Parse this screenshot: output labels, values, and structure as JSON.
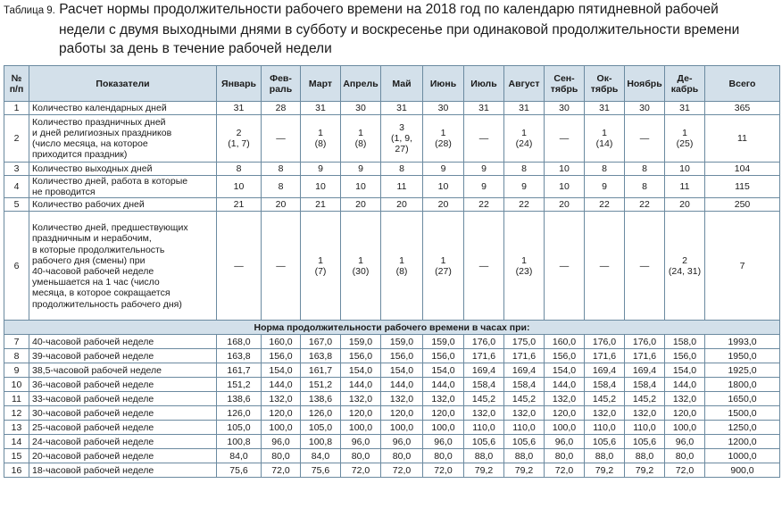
{
  "title": {
    "label": "Таблица 9.",
    "line1": "Расчет нормы продолжительности рабочего времени на 2018 год по календарю пятидневной рабочей",
    "line2": "недели с двумя выходными днями в субботу и воскресенье при одинаковой продолжительности времени",
    "line3": "работы за день в течение рабочей недели"
  },
  "headers": {
    "num": "№\nп/п",
    "indicator": "Показатели",
    "months": [
      "Январь",
      "Фев-\nраль",
      "Март",
      "Апрель",
      "Май",
      "Июнь",
      "Июль",
      "Август",
      "Сен-\nтябрь",
      "Ок-\nтябрь",
      "Ноябрь",
      "Де-\nкабрь"
    ],
    "total": "Всего"
  },
  "rows": [
    {
      "n": "1",
      "label": "Количество календарных дней",
      "vals": [
        "31",
        "28",
        "31",
        "30",
        "31",
        "30",
        "31",
        "31",
        "30",
        "31",
        "30",
        "31"
      ],
      "total": "365"
    },
    {
      "n": "2",
      "label": "Количество праздничных дней\nи дней религиозных праздников\n(число месяца, на которое\nприходится праздник)",
      "vals": [
        "2\n(1, 7)",
        "—",
        "1\n(8)",
        "1\n(8)",
        "3\n(1, 9,\n27)",
        "1\n(28)",
        "—",
        "1\n(24)",
        "—",
        "1\n(14)",
        "—",
        "1\n(25)"
      ],
      "total": "11"
    },
    {
      "n": "3",
      "label": "Количество выходных дней",
      "vals": [
        "8",
        "8",
        "9",
        "9",
        "8",
        "9",
        "9",
        "8",
        "10",
        "8",
        "8",
        "10"
      ],
      "total": "104"
    },
    {
      "n": "4",
      "label": "Количество дней, работа в которые\nне проводится",
      "vals": [
        "10",
        "8",
        "10",
        "10",
        "11",
        "10",
        "9",
        "9",
        "10",
        "9",
        "8",
        "11"
      ],
      "total": "115"
    },
    {
      "n": "5",
      "label": "Количество рабочих дней",
      "vals": [
        "21",
        "20",
        "21",
        "20",
        "20",
        "20",
        "22",
        "22",
        "20",
        "22",
        "22",
        "20"
      ],
      "total": "250"
    },
    {
      "n": "6",
      "label": "Количество дней, предшествующих\nпраздничным и нерабочим,\nв которые продолжительность\nрабочего дня (смены) при\n40-часовой рабочей неделе\nуменьшается на 1 час (число\nмесяца, в которое сокращается\nпродолжительность рабочего дня)",
      "vals": [
        "—",
        "—",
        "1\n(7)",
        "1\n(30)",
        "1\n(8)",
        "1\n(27)",
        "—",
        "1\n(23)",
        "—",
        "—",
        "—",
        "2\n(24, 31)"
      ],
      "total": "7"
    }
  ],
  "section": "Норма продолжительности рабочего времени в часах при:",
  "norm_rows": [
    {
      "n": "7",
      "label": "40-часовой рабочей неделе",
      "vals": [
        "168,0",
        "160,0",
        "167,0",
        "159,0",
        "159,0",
        "159,0",
        "176,0",
        "175,0",
        "160,0",
        "176,0",
        "176,0",
        "158,0"
      ],
      "total": "1993,0"
    },
    {
      "n": "8",
      "label": "39-часовой рабочей неделе",
      "vals": [
        "163,8",
        "156,0",
        "163,8",
        "156,0",
        "156,0",
        "156,0",
        "171,6",
        "171,6",
        "156,0",
        "171,6",
        "171,6",
        "156,0"
      ],
      "total": "1950,0"
    },
    {
      "n": "9",
      "label": "38,5-часовой рабочей неделе",
      "vals": [
        "161,7",
        "154,0",
        "161,7",
        "154,0",
        "154,0",
        "154,0",
        "169,4",
        "169,4",
        "154,0",
        "169,4",
        "169,4",
        "154,0"
      ],
      "total": "1925,0"
    },
    {
      "n": "10",
      "label": "36-часовой рабочей неделе",
      "vals": [
        "151,2",
        "144,0",
        "151,2",
        "144,0",
        "144,0",
        "144,0",
        "158,4",
        "158,4",
        "144,0",
        "158,4",
        "158,4",
        "144,0"
      ],
      "total": "1800,0"
    },
    {
      "n": "11",
      "label": "33-часовой рабочей неделе",
      "vals": [
        "138,6",
        "132,0",
        "138,6",
        "132,0",
        "132,0",
        "132,0",
        "145,2",
        "145,2",
        "132,0",
        "145,2",
        "145,2",
        "132,0"
      ],
      "total": "1650,0"
    },
    {
      "n": "12",
      "label": "30-часовой рабочей неделе",
      "vals": [
        "126,0",
        "120,0",
        "126,0",
        "120,0",
        "120,0",
        "120,0",
        "132,0",
        "132,0",
        "120,0",
        "132,0",
        "132,0",
        "120,0"
      ],
      "total": "1500,0"
    },
    {
      "n": "13",
      "label": "25-часовой рабочей неделе",
      "vals": [
        "105,0",
        "100,0",
        "105,0",
        "100,0",
        "100,0",
        "100,0",
        "110,0",
        "110,0",
        "100,0",
        "110,0",
        "110,0",
        "100,0"
      ],
      "total": "1250,0"
    },
    {
      "n": "14",
      "label": "24-часовой рабочей неделе",
      "vals": [
        "100,8",
        "96,0",
        "100,8",
        "96,0",
        "96,0",
        "96,0",
        "105,6",
        "105,6",
        "96,0",
        "105,6",
        "105,6",
        "96,0"
      ],
      "total": "1200,0"
    },
    {
      "n": "15",
      "label": "20-часовой рабочей неделе",
      "vals": [
        "84,0",
        "80,0",
        "84,0",
        "80,0",
        "80,0",
        "80,0",
        "88,0",
        "88,0",
        "80,0",
        "88,0",
        "88,0",
        "80,0"
      ],
      "total": "1000,0"
    },
    {
      "n": "16",
      "label": "18-часовой рабочей неделе",
      "vals": [
        "75,6",
        "72,0",
        "75,6",
        "72,0",
        "72,0",
        "72,0",
        "79,2",
        "79,2",
        "72,0",
        "79,2",
        "79,2",
        "72,0"
      ],
      "total": "900,0"
    }
  ]
}
